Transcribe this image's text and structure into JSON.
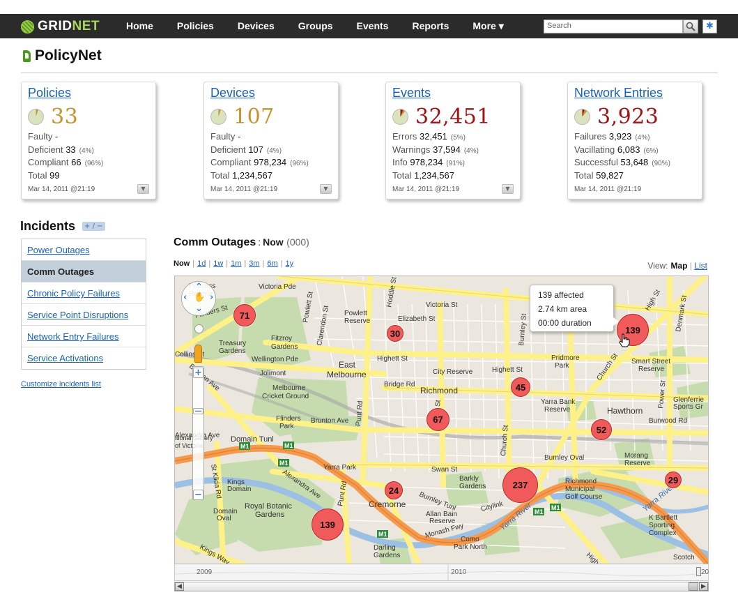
{
  "brand": {
    "name_a": "GRID",
    "name_b": "NET"
  },
  "nav": [
    "Home",
    "Policies",
    "Devices",
    "Groups",
    "Events",
    "Reports",
    "More ▾"
  ],
  "search": {
    "placeholder": "Search"
  },
  "app_name": "PolicyNet",
  "cards": [
    {
      "title": "Policies",
      "value": "33",
      "rows": [
        {
          "label": "Faulty",
          "value": "-",
          "pct": ""
        },
        {
          "label": "Deficient",
          "value": "33",
          "pct": "(4%)"
        },
        {
          "label": "Compliant",
          "value": "66",
          "pct": "(96%)"
        },
        {
          "label": "Total",
          "value": "99",
          "pct": ""
        }
      ],
      "date": "Mar 14, 2011 @21:19"
    },
    {
      "title": "Devices",
      "value": "107",
      "rows": [
        {
          "label": "Faulty",
          "value": "-",
          "pct": ""
        },
        {
          "label": "Deficient",
          "value": "107",
          "pct": "(4%)"
        },
        {
          "label": "Compliant",
          "value": "978,234",
          "pct": "(96%)"
        },
        {
          "label": "Total",
          "value": "1,234,567",
          "pct": ""
        }
      ],
      "date": "Mar 14, 2011 @21:19"
    },
    {
      "title": "Events",
      "value": "32,451",
      "rows": [
        {
          "label": "Errors",
          "value": "32,451",
          "pct": "(5%)"
        },
        {
          "label": "Warnings",
          "value": "37,594",
          "pct": "(4%)"
        },
        {
          "label": "Info",
          "value": "978,234",
          "pct": "(91%)"
        },
        {
          "label": "Total",
          "value": "1,234,567",
          "pct": ""
        }
      ],
      "date": "Mar 14, 2011 @21:19"
    },
    {
      "title": "Network Entries",
      "value": "3,923",
      "rows": [
        {
          "label": "Failures",
          "value": "3,923",
          "pct": "(4%)"
        },
        {
          "label": "Vacillating",
          "value": "6,083",
          "pct": "(6%)"
        },
        {
          "label": "Successful",
          "value": "53,648",
          "pct": "(90%)"
        },
        {
          "label": "Total",
          "value": "59,827",
          "pct": ""
        }
      ],
      "date": "Mar 14, 2011 @21:19"
    }
  ],
  "incidents": {
    "title": "Incidents",
    "toggle": "+ / −",
    "items": [
      "Power Outages",
      "Comm Outages",
      "Chronic Policy Failures",
      "Service Point Disruptions",
      "Network Entry Failures",
      "Service Activations"
    ],
    "active_index": 1,
    "customize": "Customize incidents list"
  },
  "outage": {
    "title": "Comm Outages",
    "sep": ":",
    "now": "Now",
    "count": "(000)",
    "timeframes": [
      "Now",
      "1d",
      "1w",
      "1m",
      "3m",
      "6m",
      "1y"
    ],
    "view_label": "View:",
    "view_map": "Map",
    "view_list": "List"
  },
  "clusters": [
    "71",
    "30",
    "139",
    "45",
    "67",
    "52",
    "237",
    "24",
    "139",
    "29"
  ],
  "tooltip": {
    "line1": "139 affected",
    "line2": "2.74 km area",
    "line3": "00:00 duration"
  },
  "map_labels": [
    "Victoria Pde",
    "Victoria St",
    "Elizabeth St",
    "Powlett Reserve",
    "Highett St",
    "Wellington Pde",
    "Fitzroy Gardens",
    "Treasury Gardens",
    "East Melbourne",
    "Jolimont",
    "Melbourne Cricket Ground",
    "Bridge Rd",
    "Richmond",
    "City Reserve",
    "Yarra Bank Reserve",
    "Hawthorn",
    "Pridmore Park",
    "Smart Street Reserve",
    "Burwood Rd",
    "Glenferrie Sports Gr",
    "Flinders Park",
    "Brunton Ave",
    "Punt Rd",
    "Church St",
    "Swan St",
    "Yarra Park",
    "Domain Tunl",
    "Kings Domain",
    "Royal Botanic Gardens",
    "Domain Oval",
    "Cremorne",
    "Burnley Tunl",
    "Citylink",
    "Yarra River",
    "Monash Fwy",
    "Como Park North",
    "Allan Bain Reserve",
    "Barkly Gardens",
    "Richmond Municipal Golf Course",
    "Morang Reserve",
    "K Bartlett Sporting Complex",
    "Burnley Oval",
    "Darling Gardens",
    "Alexandra Ave",
    "St Kilda Rd",
    "Kings Way",
    "Scotch Coll",
    "M1",
    "Princess Reserve",
    "Church St",
    "Burnley St",
    "High St",
    "Denmark St",
    "Power St",
    "Hoddle St",
    "Clarendon St",
    "Punt Rd",
    "Collins St",
    "Batman Ave",
    "Flinders St",
    "Alexandra Ave",
    "Yarra River"
  ],
  "timeline": {
    "label_a": "2009",
    "label_b": "2010",
    "label_c": "20"
  },
  "colors": {
    "nav_bg": "#2b2b2b",
    "link": "#1a62b8",
    "gold": "#c8922c",
    "dark_red": "#a01414",
    "cluster": "#f15a5a",
    "road_yellow": "#fdf187",
    "freeway": "#f59a4d"
  }
}
